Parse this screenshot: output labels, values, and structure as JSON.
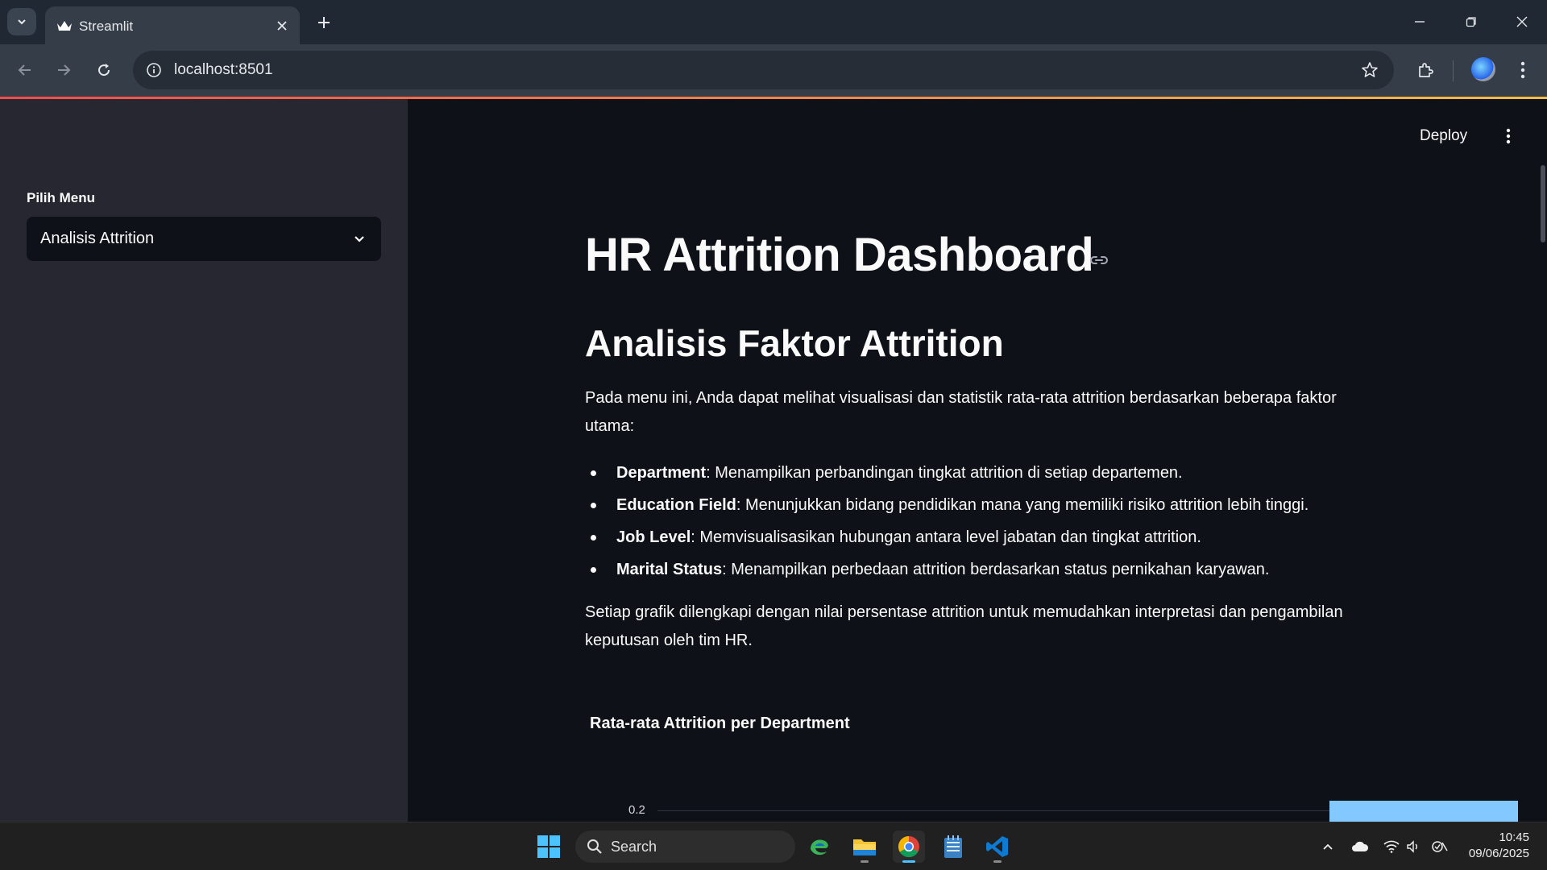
{
  "browser": {
    "tab_title": "Streamlit",
    "url": "localhost:8501"
  },
  "sidebar": {
    "menu_label": "Pilih Menu",
    "selected_menu": "Analisis Attrition"
  },
  "header": {
    "deploy_label": "Deploy"
  },
  "main": {
    "title": "HR Attrition Dashboard",
    "subtitle": "Analisis Faktor Attrition",
    "intro": "Pada menu ini, Anda dapat melihat visualisasi dan statistik rata-rata attrition berdasarkan beberapa faktor utama:",
    "factors": [
      {
        "name": "Department",
        "desc": ": Menampilkan perbandingan tingkat attrition di setiap departemen."
      },
      {
        "name": "Education Field",
        "desc": ": Menunjukkan bidang pendidikan mana yang memiliki risiko attrition lebih tinggi."
      },
      {
        "name": "Job Level",
        "desc": ": Memvisualisasikan hubungan antara level jabatan dan tingkat attrition."
      },
      {
        "name": "Marital Status",
        "desc": ": Menampilkan perbedaan attrition berdasarkan status pernikahan karyawan."
      }
    ],
    "outro": "Setiap grafik dilengkapi dengan nilai persentase attrition untuk memudahkan interpretasi dan pengambilan keputusan oleh tim HR.",
    "chart_title": "Rata-rata Attrition per Department",
    "chart_tick": "0.2"
  },
  "taskbar": {
    "search_label": "Search",
    "time": "10:45",
    "date": "09/06/2025"
  },
  "colors": {
    "accent": "#ff4b4b",
    "bar": "#83c9ff",
    "sidebar_bg": "#262730",
    "main_bg": "#0e1117"
  }
}
